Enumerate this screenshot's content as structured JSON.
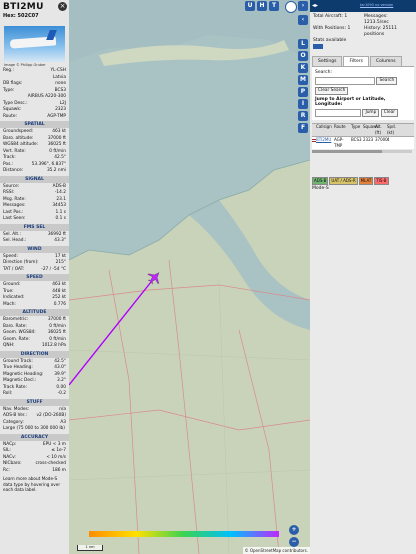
{
  "aircraft": {
    "callsign": "BTI2MU",
    "hex": "Hex: 502C07",
    "photo_credit": "Image © Philipp Gruber",
    "reg_rows": [
      {
        "k": "Reg.:",
        "v": "YL-CSH"
      },
      {
        "k": "",
        "v": "Latvia"
      },
      {
        "k": "DB flags:",
        "v": "none"
      },
      {
        "k": "Type:",
        "v": "BCS3"
      },
      {
        "k": "",
        "v": "AIRBUS A220-300"
      },
      {
        "k": "Type Desc.:",
        "v": "L2J"
      },
      {
        "k": "Squawk:",
        "v": "2323"
      },
      {
        "k": "Route:",
        "v": "AGP-TMP"
      }
    ]
  },
  "sections": {
    "spatial": "SPATIAL",
    "signal": "SIGNAL",
    "fms": "FMS SEL",
    "wind": "WIND",
    "speed": "SPEED",
    "altitude": "ALTITUDE",
    "direction": "DIRECTION",
    "stuff": "STUFF",
    "accuracy": "ACCURACY"
  },
  "spatial_rows": [
    {
      "k": "Groundspeed:",
      "v": "463 kt"
    },
    {
      "k": "Baro. altitude:",
      "v": "37000 ft"
    },
    {
      "k": "WGS84 altitude:",
      "v": "36025 ft"
    },
    {
      "k": "Vert. Rate:",
      "v": "0 ft/min"
    },
    {
      "k": "Track:",
      "v": "42.5°"
    },
    {
      "k": "Pos.:",
      "v": "53.396°, 6.837°"
    },
    {
      "k": "Distance:",
      "v": "35.2 nmi"
    }
  ],
  "signal_rows": [
    {
      "k": "Source:",
      "v": "ADS-B"
    },
    {
      "k": "RSSI:",
      "v": "-14.2"
    },
    {
      "k": "Msg. Rate:",
      "v": "23.1"
    },
    {
      "k": "Messages:",
      "v": "34453"
    },
    {
      "k": "Last Pos.:",
      "v": "1.1 s"
    },
    {
      "k": "Last Seen:",
      "v": "0.1 s"
    }
  ],
  "fms_rows": [
    {
      "k": "Sel. Alt.:",
      "v": "36992 ft"
    },
    {
      "k": "Sel. Head.:",
      "v": "43.3°"
    }
  ],
  "wind_rows": [
    {
      "k": "Speed:",
      "v": "17 kt"
    },
    {
      "k": "Direction (from):",
      "v": "215°"
    },
    {
      "k": "TAT / OAT:",
      "v": "-27 / -54 °C"
    }
  ],
  "speed_rows": [
    {
      "k": "Ground:",
      "v": "463 kt"
    },
    {
      "k": "True:",
      "v": "448 kt"
    },
    {
      "k": "Indicated:",
      "v": "252 kt"
    },
    {
      "k": "Mach:",
      "v": "0.776"
    }
  ],
  "altitude_rows": [
    {
      "k": "Barometric:",
      "v": "37000 ft"
    },
    {
      "k": "Baro. Rate:",
      "v": "0 ft/min"
    },
    {
      "k": "Geom. WGS84:",
      "v": "36025 ft"
    },
    {
      "k": "Geom. Rate:",
      "v": "0 ft/min"
    },
    {
      "k": "QNH:",
      "v": "1012.8 hPa"
    }
  ],
  "direction_rows": [
    {
      "k": "Ground Track:",
      "v": "42.5°"
    },
    {
      "k": "True Heading:",
      "v": "43.0°"
    },
    {
      "k": "Magnetic Heading:",
      "v": "39.9°"
    },
    {
      "k": "Magnetic Decl.:",
      "v": "3.2°"
    },
    {
      "k": "Track Rate:",
      "v": "0.00"
    },
    {
      "k": "Roll:",
      "v": "-0.2"
    }
  ],
  "stuff_rows": [
    {
      "k": "Nav. Modes:",
      "v": "n/a"
    },
    {
      "k": "ADS-B Ver.:",
      "v": "v2 (DO-260B)"
    },
    {
      "k": "Category:",
      "v": "A3"
    },
    {
      "k": "Large (75 000 to 300 000 lb)",
      "v": ""
    }
  ],
  "accuracy_rows": [
    {
      "k": "NACp:",
      "v": "EPU < 3 m"
    },
    {
      "k": "SIL:",
      "v": "≤ 1e-7"
    },
    {
      "k": "NACv:",
      "v": "< 10 m/s"
    },
    {
      "k": "NICbaro:",
      "v": "cross-checked"
    },
    {
      "k": "Rc:",
      "v": "186 m"
    }
  ],
  "note": "Learn more about Mode-S data type by hovering over each data label.",
  "map": {
    "top_buttons": [
      "U",
      "H",
      "T"
    ],
    "side_buttons": [
      "L",
      "O",
      "K",
      "M",
      "P",
      "I",
      "R",
      "F"
    ],
    "attribution": "© OpenStreetMap contributors.",
    "scale": "1 nm",
    "zoom_in": "+",
    "zoom_out": "−"
  },
  "right": {
    "version": "tar1090 no version",
    "total_aircraft": "Total Aircraft: 1",
    "messages": "Messages: 1213.5/sec",
    "with_positions": "With Positions: 1",
    "history": "History: 25111 positions",
    "stats_available": "Stats available",
    "tabs": [
      "Settings",
      "Filters",
      "Columns"
    ],
    "search_label": "Search:",
    "search_button": "Search",
    "clear_search": "Clear Search",
    "jump_label": "Jump to Airport or Latitude, Longitude:",
    "jump_button": "Jump",
    "clear_button": "Clear",
    "columns": [
      "",
      "Callsign",
      "Route",
      "Type",
      "Squawk",
      "Alt. (ft)",
      "Spd. (kt)"
    ],
    "row": [
      "",
      "BTI2MU",
      "AGP-TMP",
      "BCS3",
      "2323",
      "37000",
      "4"
    ],
    "legend": [
      "ADS-B",
      "UAT / ADS-R",
      "MLAT",
      "TIS-B"
    ],
    "legend_colors": [
      "#6fb56f",
      "#d7c36a",
      "#e4823b",
      "#ff6a6a"
    ],
    "mode_s": "Mode-S"
  },
  "colors": {
    "accent": "#2a5ea8",
    "section_text": "#1a3d7c",
    "track": "#b000ff",
    "sea": "#a9c3c5",
    "land": "#c8d2b8"
  }
}
